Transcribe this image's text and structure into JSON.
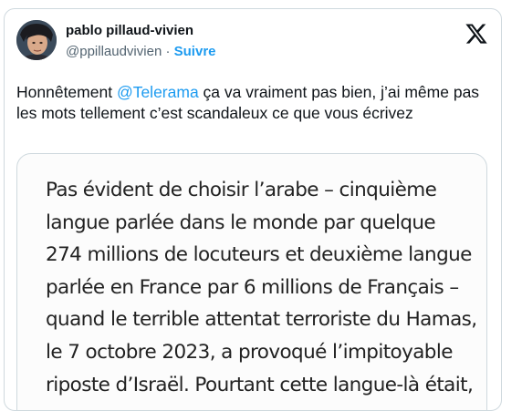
{
  "author": {
    "name": "pablo pillaud-vivien",
    "handle": "@ppillaudvivien",
    "separator": "·",
    "follow_label": "Suivre"
  },
  "icons": {
    "logo": "x-logo-icon",
    "avatar": "user-avatar"
  },
  "tweet": {
    "text_before_mention": "Honnêtement ",
    "mention": "@Telerama",
    "text_after_mention": " ça va vraiment pas bien, j’ai même pas les mots tellement c’est scandaleux ce que vous écrivez"
  },
  "media": {
    "lines": [
      "Pas évident de choisir l’arabe – cinquième",
      "langue parlée dans le monde par quelque",
      "274 millions de locuteurs et deuxième langue",
      "parlée en France par 6 millions de Français –",
      "quand le terrible attentat terroriste du Hamas,",
      "le 7 octobre 2023, a provoqué l’impitoyable",
      "riposte d’Israël. Pourtant cette langue-là était,"
    ]
  },
  "colors": {
    "link": "#1d9bf0",
    "secondary_text": "#536471",
    "border": "#cfd9de"
  }
}
